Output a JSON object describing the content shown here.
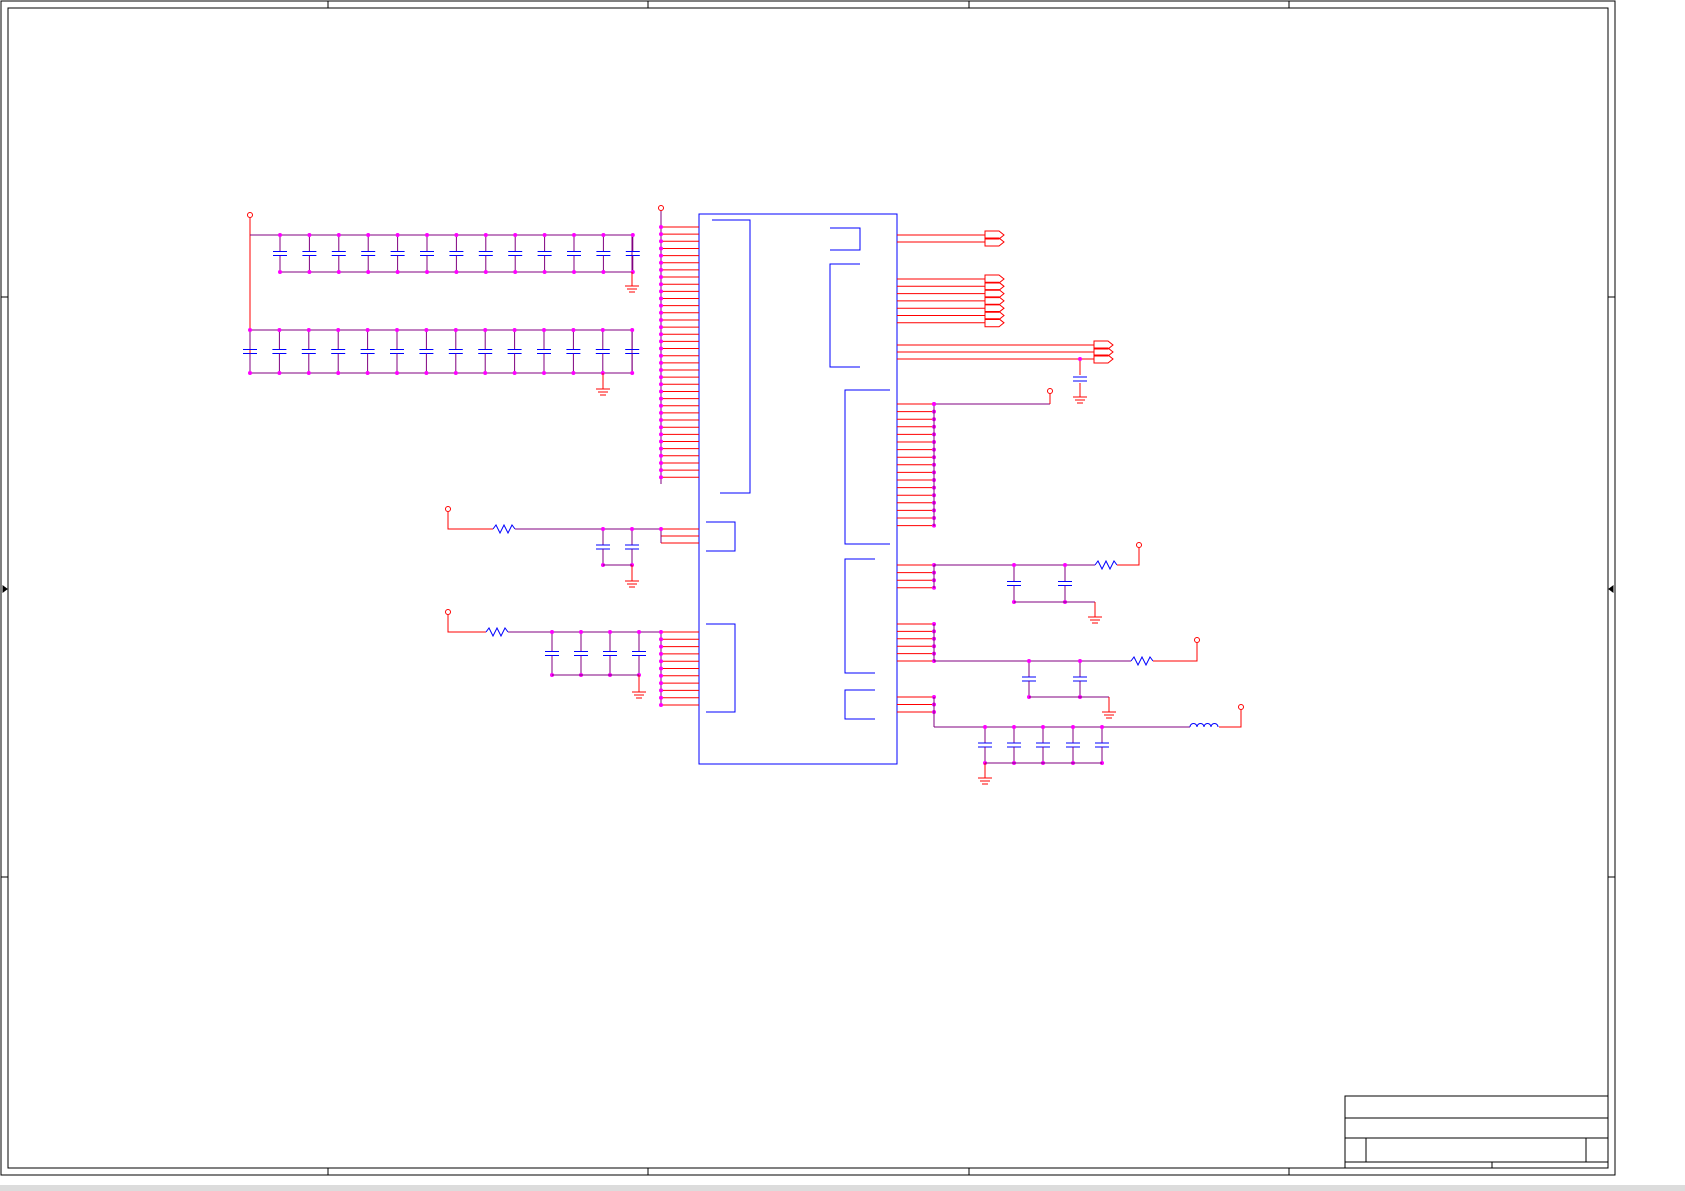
{
  "colors": {
    "background": "#ffffff",
    "frame": "#000000",
    "wire": "#ff0000",
    "net": "#800080",
    "junction": "#ff00ff",
    "part": "#0000ff",
    "strip": "#dcdcdc"
  },
  "icons": {
    "power_pin": "open-circle-power-icon",
    "ground": "ground-symbol-icon",
    "offpage": "off-page-connector-icon"
  },
  "title_block": {
    "title": "",
    "sheet": ""
  }
}
